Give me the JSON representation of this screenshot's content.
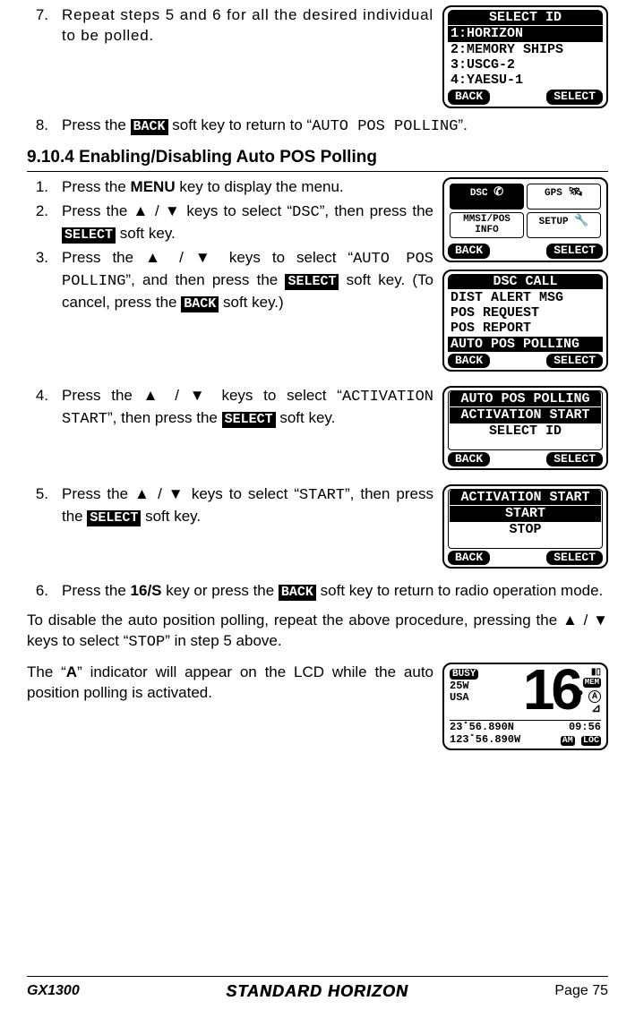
{
  "step7": {
    "num": "7.",
    "text": "Repeat steps 5 and 6 for all the desired individual to be polled."
  },
  "lcd_select_id": {
    "title": "SELECT ID",
    "l1": "1:HORIZON",
    "l2": "2:MEMORY SHIPS",
    "l3": "3:USCG-2",
    "l4": "4:YAESU-1",
    "back": "BACK",
    "select": "SELECT"
  },
  "step8": {
    "num": "8.",
    "a": "Press the ",
    "key": "BACK",
    "b": " soft key to return to “",
    "mono": "AUTO POS POLLING",
    "c": "”."
  },
  "section": "9.10.4  Enabling/Disabling Auto POS Polling",
  "steps_b": {
    "s1": {
      "num": "1.",
      "a": "Press the ",
      "bold": "MENU",
      "b": " key to display the menu."
    },
    "s2": {
      "num": "2.",
      "a": "Press the ▲ / ▼ keys to select “",
      "mono": "DSC",
      "b": "”, then press the ",
      "key": "SELECT",
      "c": " soft key."
    },
    "s3": {
      "num": "3.",
      "a": "Press the ▲ / ▼ keys to select “",
      "mono": "AUTO POS POLLING",
      "b": "”, and then press the ",
      "key1": "SELECT",
      "c": " soft key. (To cancel, press the ",
      "key2": "BACK",
      "d": " soft key.)"
    },
    "s4": {
      "num": "4.",
      "a": "Press the ▲ / ▼ keys to select “",
      "mono": "ACTIVATION START",
      "b": "”, then press the ",
      "key": "SELECT",
      "c": " soft key."
    },
    "s5": {
      "num": "5.",
      "a": "Press the ▲ / ▼ keys to select “",
      "mono": "START",
      "b": "”, then press the ",
      "key": "SELECT",
      "c": " soft key."
    },
    "s6": {
      "num": "6.",
      "a": "Press the ",
      "bold": "16/S",
      "b": " key or press the ",
      "key": "BACK",
      "c": " soft key to return to radio operation mode."
    }
  },
  "lcd_menu": {
    "c1": "DSC",
    "c2": "GPS",
    "c3a": "MMSI/POS",
    "c3b": "INFO",
    "c4": "SETUP",
    "back": "BACK",
    "select": "SELECT"
  },
  "lcd_dsc_call": {
    "title": "DSC CALL",
    "l1": "DIST ALERT MSG",
    "l2": "POS REQUEST",
    "l3": "POS REPORT",
    "sel": "AUTO POS POLLING",
    "back": "BACK",
    "select": "SELECT"
  },
  "lcd_auto_pos": {
    "title": "AUTO POS POLLING",
    "sel": "ACTIVATION START",
    "l2": "SELECT ID",
    "back": "BACK",
    "select": "SELECT"
  },
  "lcd_activation": {
    "title": "ACTIVATION START",
    "sel": "START",
    "l2": "STOP",
    "back": "BACK",
    "select": "SELECT"
  },
  "para_disable": {
    "a": "To disable the auto position polling, repeat the above procedure, pressing the ▲ / ▼ keys to select “",
    "mono": "STOP",
    "b": "” in step 5 above."
  },
  "para_indicator": {
    "a": "The “",
    "bold": "A",
    "b": "” indicator will appear on the LCD while the auto position polling is activated."
  },
  "lcd_radio": {
    "busy": "BUSY",
    "pw": "25W",
    "region": "USA",
    "mem": "MEM",
    "p": "P",
    "a": "A",
    "ch": "16",
    "lat": " 23˚56.890N",
    "lon": "123˚56.890W",
    "time": "09:56",
    "am": "AM",
    "loc": "LOC"
  },
  "footer": {
    "model": "GX1300",
    "brand": "STANDARD HORIZON",
    "page": "Page 75"
  }
}
